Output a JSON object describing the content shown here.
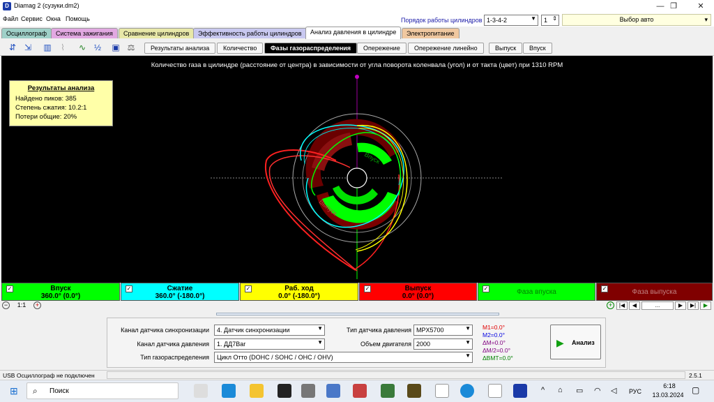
{
  "window": {
    "title": "Diamag 2 (сузуки.dm2)",
    "icon": "app-icon"
  },
  "menu": [
    "Файл",
    "Сервис",
    "Окна",
    "Помощь"
  ],
  "cylinders": {
    "order_label": "Порядок работы цилиндров",
    "order_value": "1-3-4-2",
    "cyl_value": "1",
    "auto_label": "Выбор авто"
  },
  "tabs": [
    {
      "label": "Осциллограф",
      "color": "#9fd0c8"
    },
    {
      "label": "Система зажигания",
      "color": "#e2a8e2"
    },
    {
      "label": "Сравнение цилиндров",
      "color": "#e8e8a8"
    },
    {
      "label": "Эффективность работы цилиндров",
      "color": "#c8c8f0"
    },
    {
      "label": "Анализ давления в цилиндре",
      "color": "#ffffff"
    },
    {
      "label": "Электропитание",
      "color": "#f0c8a0"
    }
  ],
  "subtabs": [
    "Результаты анализа",
    "Количество",
    "Фазы газораспределения",
    "Опережение",
    "Опережение линейно",
    "Выпуск",
    "Впуск"
  ],
  "chart": {
    "title": "Количество газа в цилиндре (расстояние от центра) в зависимости от угла поворота коленвала (угол) и от такта (цвет) при 1310 RPM",
    "ring_labels": {
      "intake": "Впуск",
      "exhaust": "Выпуск"
    }
  },
  "results": {
    "heading": "Результаты анализа",
    "peaks": "Найдено пиков: 385",
    "compression": "Степень сжатия: 10.2:1",
    "losses": "Потери общие: 20%"
  },
  "phases": [
    {
      "name": "Впуск",
      "value": "360.0° (0.0°)",
      "color": "#00ff00",
      "text": "#000000"
    },
    {
      "name": "Сжатие",
      "value": "360.0° (-180.0°)",
      "color": "#00ffff",
      "text": "#000000"
    },
    {
      "name": "Раб. ход",
      "value": "0.0° (-180.0°)",
      "color": "#ffff00",
      "text": "#000000"
    },
    {
      "name": "Выпуск",
      "value": "0.0° (0.0°)",
      "color": "#ff0000",
      "text": "#000000"
    },
    {
      "name": "Фаза впуска",
      "value": "",
      "color": "#00ff00",
      "text": "#008000"
    },
    {
      "name": "Фаза выпуска",
      "value": "",
      "color": "#800000",
      "text": "#c08080"
    }
  ],
  "zoom": "1:1",
  "nav_ellipsis": "...",
  "settings": {
    "sync_channel_label": "Канал датчика синхронизации",
    "sync_channel_value": "4. Датчик синхронизации",
    "pressure_channel_label": "Канал датчика давления",
    "pressure_channel_value": "1. ДД7Bar",
    "timing_type_label": "Тип газораспределения",
    "timing_type_value": "Цикл Отто (DOHC / SOHC / OHC / OHV)",
    "pressure_sensor_label": "Тип датчика давления",
    "pressure_sensor_value": "MPX5700",
    "engine_volume_label": "Объем двигателя",
    "engine_volume_value": "2000",
    "markers": [
      {
        "text": "M1=0.0°",
        "color": "#e00000"
      },
      {
        "text": "M2=0.0°",
        "color": "#0000e0"
      },
      {
        "text": "ΔM=0.0°",
        "color": "#800080"
      },
      {
        "text": "ΔM/2=0.0°",
        "color": "#800080"
      },
      {
        "text": "ΔBMT=0.0°",
        "color": "#008000"
      }
    ],
    "analyze_button": "Анализ"
  },
  "status": {
    "usb": "USB Осциллограф не подключен",
    "version": "2.5.1"
  },
  "taskbar": {
    "search": "Поиск",
    "lang": "РУС",
    "time": "6:18",
    "date": "13.03.2024"
  }
}
